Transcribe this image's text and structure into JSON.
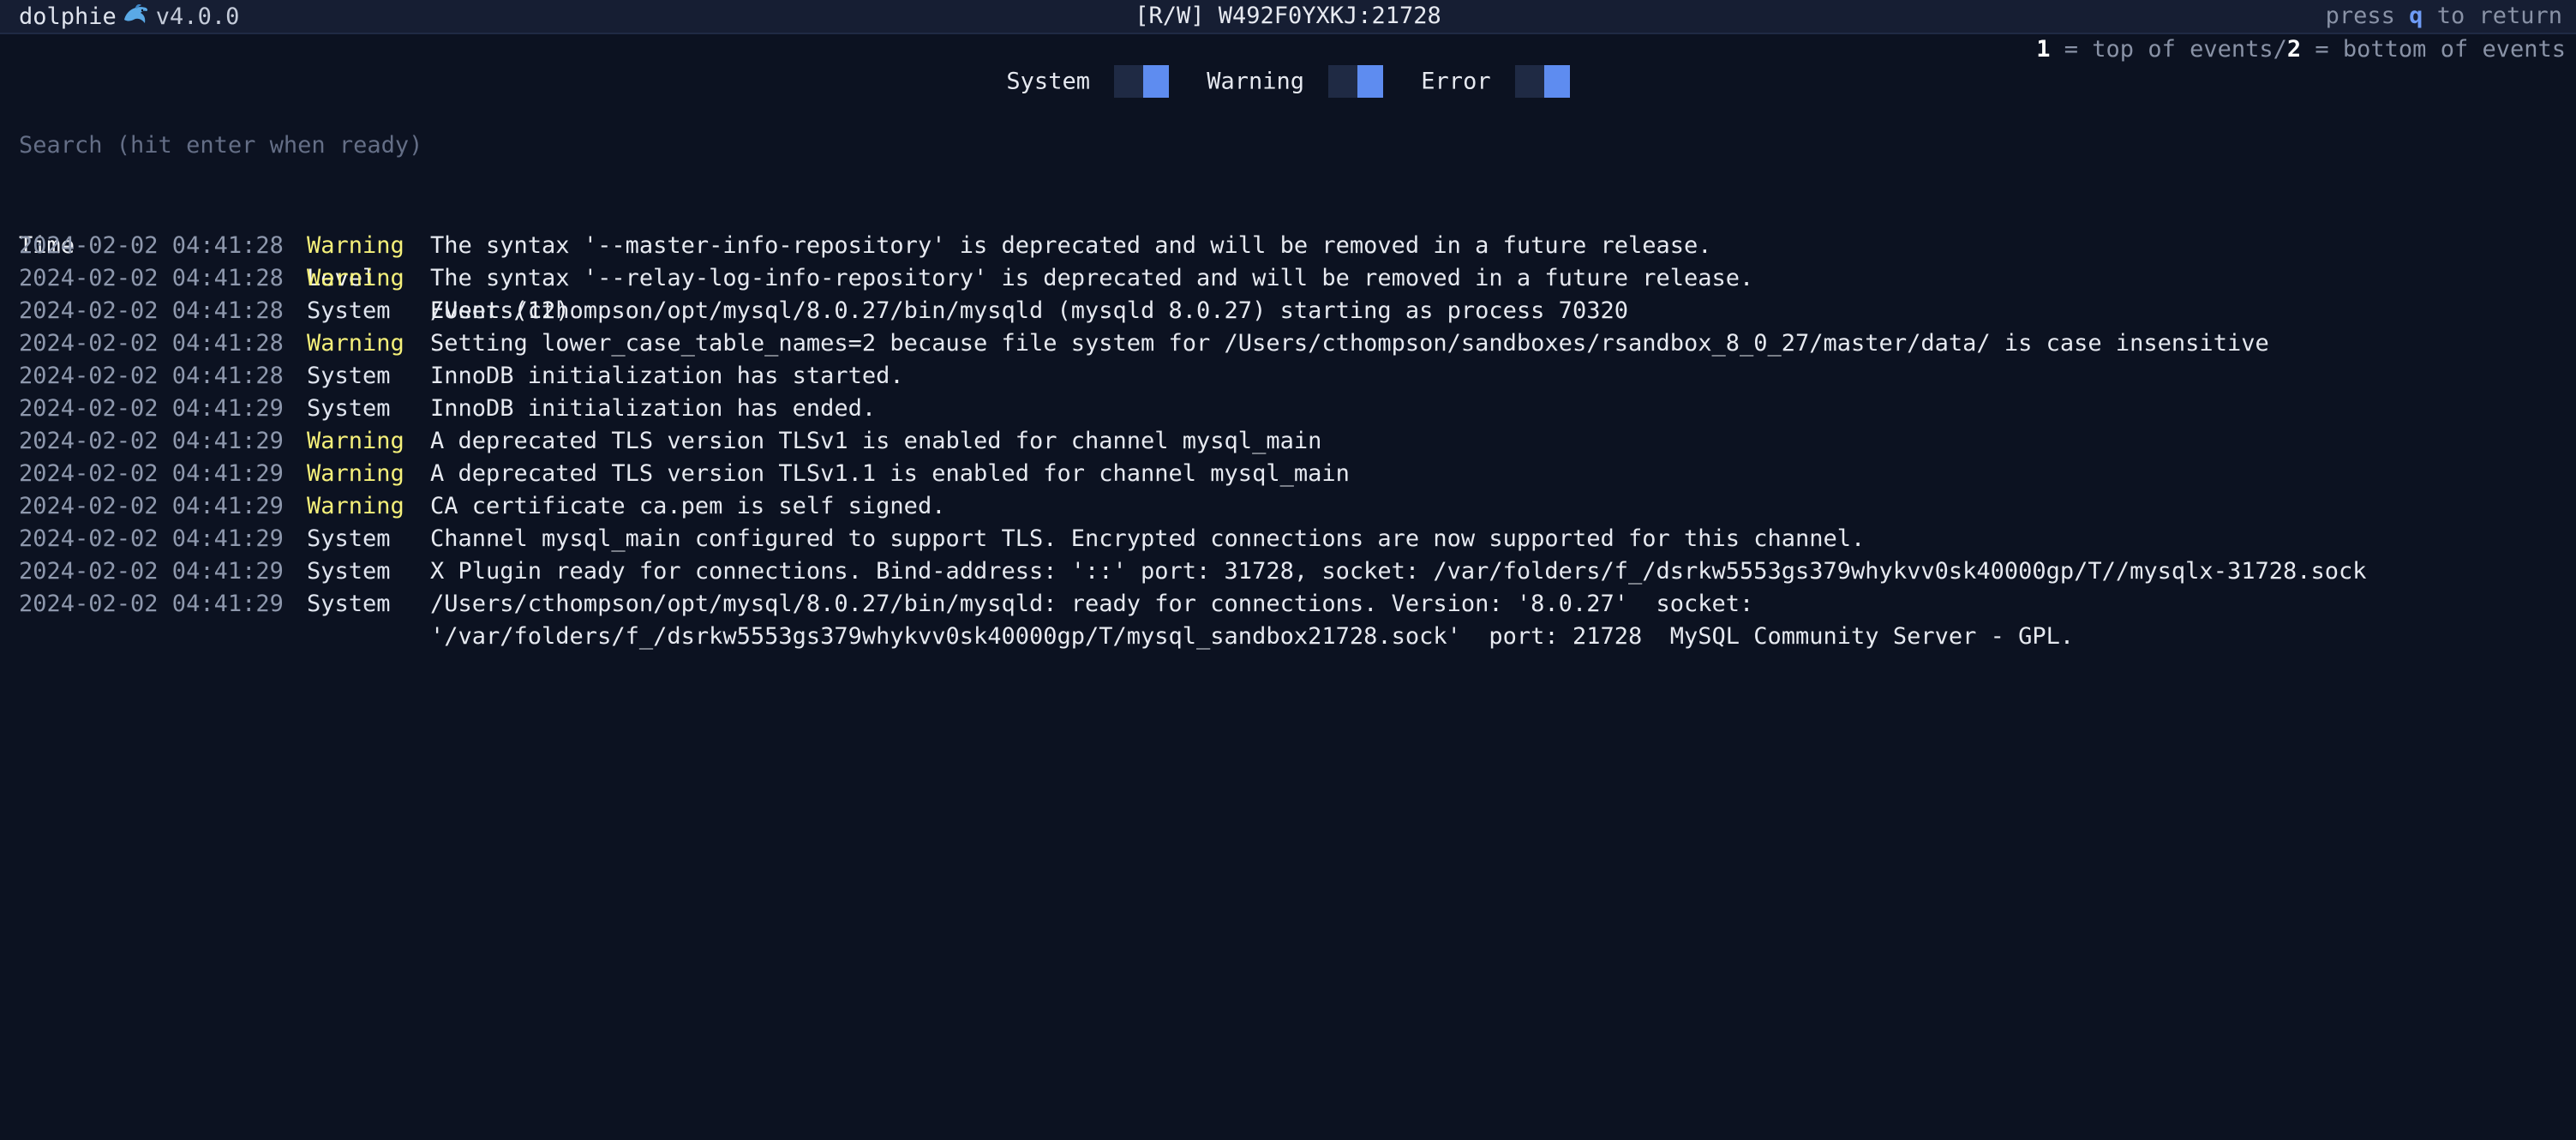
{
  "topbar": {
    "app_name": "dolphie",
    "version": "v4.0.0",
    "connection": "[R/W] W492F0YXKJ:21728",
    "return_prefix": "press ",
    "return_key": "q",
    "return_suffix": " to return"
  },
  "hint": {
    "key1": "1",
    "text1": " = top of events/",
    "key2": "2",
    "text2": " = bottom of events"
  },
  "filters": {
    "system": {
      "label": "System",
      "on": true
    },
    "warning": {
      "label": "Warning",
      "on": true
    },
    "error": {
      "label": "Error",
      "on": true
    }
  },
  "search": {
    "placeholder": "Search (hit enter when ready)"
  },
  "table": {
    "headers": {
      "time": "Time",
      "level": "Level",
      "event": "Event (12)"
    },
    "rows": [
      {
        "time": "2024-02-02 04:41:28",
        "level": "Warning",
        "event": "The syntax '--master-info-repository' is deprecated and will be removed in a future release."
      },
      {
        "time": "2024-02-02 04:41:28",
        "level": "Warning",
        "event": "The syntax '--relay-log-info-repository' is deprecated and will be removed in a future release."
      },
      {
        "time": "2024-02-02 04:41:28",
        "level": "System",
        "event": "/Users/cthompson/opt/mysql/8.0.27/bin/mysqld (mysqld 8.0.27) starting as process 70320"
      },
      {
        "time": "2024-02-02 04:41:28",
        "level": "Warning",
        "event": "Setting lower_case_table_names=2 because file system for /Users/cthompson/sandboxes/rsandbox_8_0_27/master/data/ is case insensitive"
      },
      {
        "time": "2024-02-02 04:41:28",
        "level": "System",
        "event": "InnoDB initialization has started."
      },
      {
        "time": "2024-02-02 04:41:29",
        "level": "System",
        "event": "InnoDB initialization has ended."
      },
      {
        "time": "2024-02-02 04:41:29",
        "level": "Warning",
        "event": "A deprecated TLS version TLSv1 is enabled for channel mysql_main"
      },
      {
        "time": "2024-02-02 04:41:29",
        "level": "Warning",
        "event": "A deprecated TLS version TLSv1.1 is enabled for channel mysql_main"
      },
      {
        "time": "2024-02-02 04:41:29",
        "level": "Warning",
        "event": "CA certificate ca.pem is self signed."
      },
      {
        "time": "2024-02-02 04:41:29",
        "level": "System",
        "event": "Channel mysql_main configured to support TLS. Encrypted connections are now supported for this channel."
      },
      {
        "time": "2024-02-02 04:41:29",
        "level": "System",
        "event": "X Plugin ready for connections. Bind-address: '::' port: 31728, socket: /var/folders/f_/dsrkw5553gs379whykvv0sk40000gp/T//mysqlx-31728.sock"
      },
      {
        "time": "2024-02-02 04:41:29",
        "level": "System",
        "event": "/Users/cthompson/opt/mysql/8.0.27/bin/mysqld: ready for connections. Version: '8.0.27'  socket:",
        "event_cont": "'/var/folders/f_/dsrkw5553gs379whykvv0sk40000gp/T/mysql_sandbox21728.sock'  port: 21728  MySQL Community Server - GPL."
      }
    ]
  },
  "colors": {
    "background": "#0c1221",
    "topbar": "#161e33",
    "accent_blue": "#5e8cf0",
    "warning": "#f5f07a",
    "muted": "#8992a6"
  },
  "icons": {
    "logo": "dolphin-icon"
  }
}
